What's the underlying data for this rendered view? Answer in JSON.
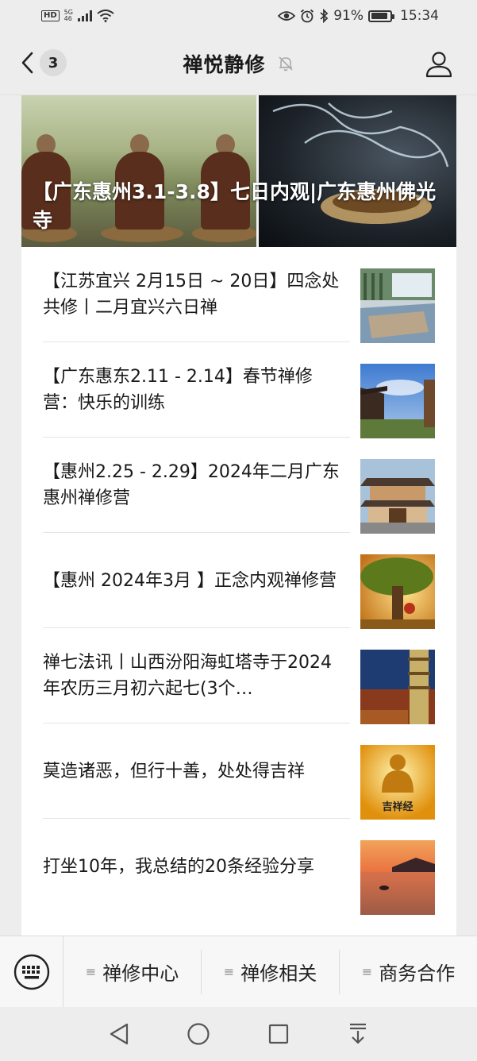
{
  "status_bar": {
    "hd_label": "HD",
    "network_label": "5G",
    "network_sub": "46",
    "battery_text": "91%",
    "battery_level": 0.91,
    "time": "15:34"
  },
  "header": {
    "back_badge": "3",
    "title": "禅悦静修"
  },
  "banner": {
    "title": "【广东惠州3.1-3.8】七日内观|广东惠州佛光寺"
  },
  "articles": [
    {
      "title": "【江苏宜兴 2月15日 ~ 20日】四念处共修丨二月宜兴六日禅"
    },
    {
      "title": "【广东惠东2.11 - 2.14】春节禅修营：快乐的训练"
    },
    {
      "title": "【惠州2.25 - 2.29】2024年二月广东惠州禅修营"
    },
    {
      "title": "【惠州 2024年3月 】正念内观禅修营"
    },
    {
      "title": "禅七法讯丨山西汾阳海虹塔寺于2024年农历三月初六起七(3个…"
    },
    {
      "title": "莫造诸恶，但行十善，处处得吉祥"
    },
    {
      "title": "打坐10年，我总结的20条经验分享"
    }
  ],
  "thumb_labels": {
    "jixiang": "吉祥经"
  },
  "bottom_menu": {
    "items": [
      "禅修中心",
      "禅修相关",
      "商务合作"
    ]
  },
  "colors": {
    "background": "#ededed",
    "card": "#ffffff",
    "text": "#191919"
  }
}
